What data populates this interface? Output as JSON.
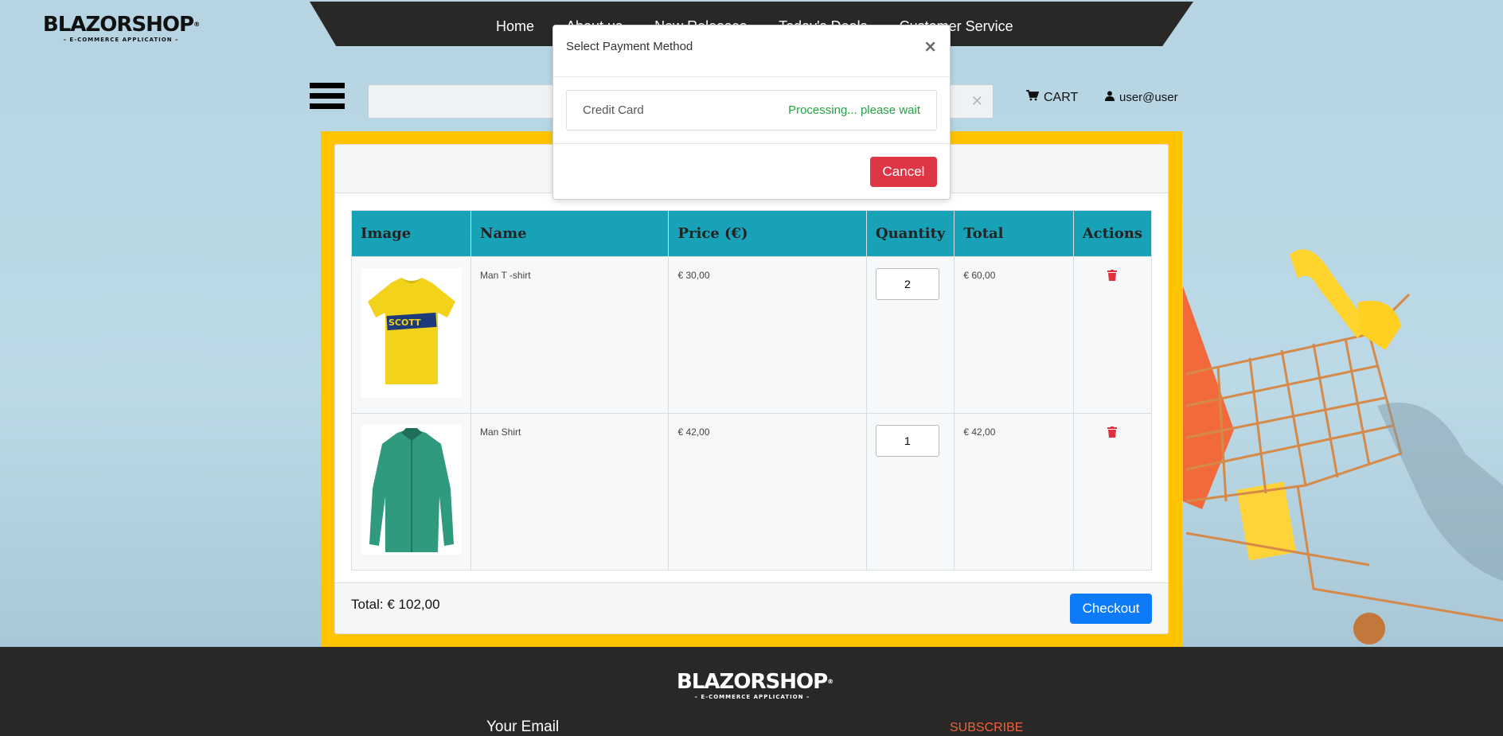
{
  "header": {
    "logo": {
      "brand": "BLAZORSHOP",
      "tagline": "– E-COMMERCE APPLICATION –"
    },
    "nav": [
      "Home",
      "About us",
      "New Releases",
      "Today's Deals",
      "Customer Service"
    ],
    "cart_label": "CART",
    "user_label": "user@user",
    "search": {
      "value": "",
      "placeholder": ""
    }
  },
  "cart": {
    "columns": [
      "Image",
      "Name",
      "Price (€)",
      "Quantity",
      "Total",
      "Actions"
    ],
    "rows": [
      {
        "name": "Man T -shirt",
        "price": "€ 30,00",
        "quantity": "2",
        "total": "€ 60,00"
      },
      {
        "name": "Man Shirt",
        "price": "€ 42,00",
        "quantity": "1",
        "total": "€ 42,00"
      }
    ],
    "total": "Total: € 102,00",
    "checkout_label": "Checkout"
  },
  "modal": {
    "title": "Select Payment Method",
    "method": "Credit Card",
    "status": "Processing... please wait",
    "cancel_label": "Cancel"
  },
  "footer": {
    "logo": {
      "brand": "BLAZORSHOP",
      "tagline": "– E-COMMERCE APPLICATION –"
    },
    "email_label": "Your Email",
    "subscribe_label": "SUBSCRIBE"
  },
  "colors": {
    "accent_yellow": "#ffc300",
    "table_header": "#18a2b8",
    "primary": "#0d7bf7",
    "danger": "#de3645",
    "success": "#25a244",
    "dark": "#2a2826"
  }
}
